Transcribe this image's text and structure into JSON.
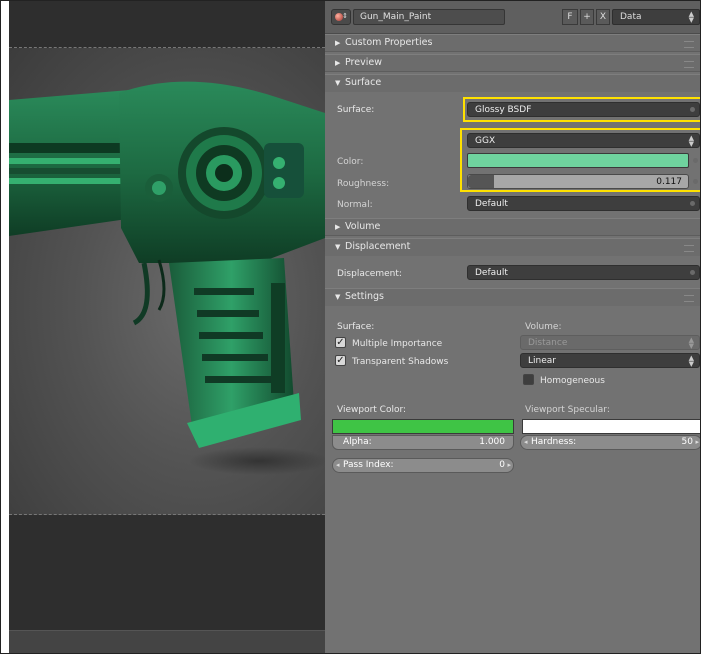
{
  "colors": {
    "surface_color": "#6fd39e",
    "viewport_color": "#3fc445",
    "viewport_specular": "#ffffff",
    "highlight": "#ffe100",
    "panel_bg": "#727272"
  },
  "header": {
    "material_name": "Gun_Main_Paint",
    "fake_user_label": "F",
    "new_label": "+",
    "delete_label": "X",
    "link_selector": "Data"
  },
  "sections": {
    "custom_properties": "Custom Properties",
    "preview": "Preview",
    "surface": "Surface",
    "volume": "Volume",
    "displacement": "Displacement",
    "settings": "Settings"
  },
  "surface": {
    "surface_label": "Surface:",
    "shader": "Glossy BSDF",
    "distribution": "GGX",
    "color_label": "Color:",
    "roughness_label": "Roughness:",
    "roughness_value": "0.117",
    "roughness_fraction": 0.117,
    "normal_label": "Normal:",
    "normal_value": "Default"
  },
  "displacement": {
    "label": "Displacement:",
    "value": "Default"
  },
  "settings": {
    "surface_label": "Surface:",
    "volume_label": "Volume:",
    "multiple_importance": "Multiple Importance",
    "transparent_shadows": "Transparent Shadows",
    "volume_sampling": "Distance",
    "volume_interpolation": "Linear",
    "homogeneous": "Homogeneous",
    "viewport_color_label": "Viewport Color:",
    "viewport_specular_label": "Viewport Specular:",
    "alpha_label": "Alpha:",
    "alpha_value": "1.000",
    "hardness_label": "Hardness:",
    "hardness_value": "50",
    "pass_index_label": "Pass Index:",
    "pass_index_value": "0"
  },
  "icons": {
    "material": "material-sphere-icon",
    "expand": "triangle-right-icon",
    "collapse": "triangle-down-icon",
    "checkbox": "check-icon"
  }
}
